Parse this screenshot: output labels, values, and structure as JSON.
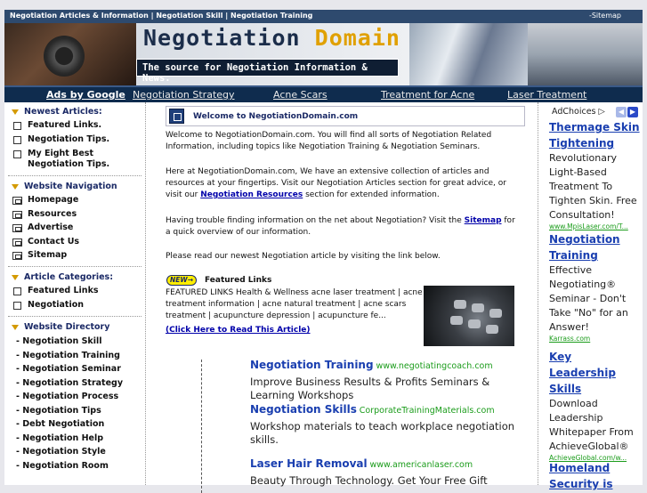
{
  "topbar": {
    "left_text": "Negotiation Articles & Information | Negotiation Skill | Negotiation Training",
    "right_text": "-Sitemap"
  },
  "banner": {
    "title_part1": "Negotiation",
    "title_part2": "Domain",
    "tagline": "The source for Negotiation Information & News."
  },
  "nav": {
    "ads_label": "Ads by Google",
    "links": [
      "Negotiation Strategy",
      "Acne Scars",
      "Treatment for Acne",
      "Laser Treatment"
    ]
  },
  "left": {
    "newest_heading": "Newest Articles:",
    "newest": [
      "Featured Links.",
      "Negotiation Tips.",
      "My Eight Best Negotiation Tips."
    ],
    "nav_heading": "Website Navigation",
    "nav_items": [
      "Homepage",
      "Resources",
      "Advertise",
      "Contact Us",
      "Sitemap"
    ],
    "cat_heading": "Article Categories:",
    "categories": [
      "Featured Links",
      "Negotiation"
    ],
    "dir_heading": "Website Directory",
    "directory": [
      "- Negotiation Skill",
      "- Negotiation Training",
      "- Negotiation Seminar",
      "- Negotiation Strategy",
      "- Negotiation Process",
      "- Negotiation Tips",
      "- Debt Negotiation",
      "- Negotiation Help",
      "- Negotiation Style",
      "- Negotiation Room"
    ]
  },
  "center": {
    "welcome_title": "Welcome to NegotiationDomain.com",
    "p1": "Welcome to NegotiationDomain.com. You will find all sorts of Negotiation Related Information, including topics like Negotiation Training & Negotiation Seminars.",
    "p2_a": "Here at NegotiationDomain.com, We have an extensive collection of articles and resources at your fingertips. Visit our Negotiation Articles section for great advice, or visit our ",
    "p2_link": "Negotiation Resources",
    "p2_b": " section for extended information.",
    "p3_a": "Having trouble finding information on the net about Negotiation? Visit the ",
    "p3_link": "Sitemap",
    "p3_b": " for a quick overview of our information.",
    "p4": "Please read our newest Negotiation article by visiting the link below.",
    "new_badge": "NEW",
    "feat_title": "Featured Links",
    "feat_text": "FEATURED LINKS Health & Wellness acne laser treatment | acne treatment information | acne natural treatment | acne scars treatment | acupuncture depression | acupuncture fe...",
    "feat_link": "(Click Here to Read This Article)",
    "ads": [
      {
        "title": "Negotiation Training",
        "domain": "www.negotiatingcoach.com",
        "body": "Improve Business Results & Profits Seminars & Learning Workshops"
      },
      {
        "title": "Negotiation Skills",
        "domain": "CorporateTrainingMaterials.com",
        "body": "Workshop materials to teach workplace negotiation skills."
      },
      {
        "title": "Laser Hair Removal",
        "domain": "www.americanlaser.com",
        "body": "Beauty Through Technology. Get Your Free Gift"
      }
    ]
  },
  "right": {
    "adchoices": "AdChoices",
    "ads": [
      {
        "title": "Thermage Skin Tightening",
        "body": "Revolutionary Light-Based Treatment To Tighten Skin. Free Consultation!",
        "url": "www.MpisLaser.com/T..."
      },
      {
        "title": "Negotiation Training",
        "body": "Effective Negotiating® Seminar - Don't Take \"No\" for an Answer!",
        "url": "Karrass.com"
      },
      {
        "title": "Key Leadership Skills",
        "body": "Download Leadership Whitepaper From AchieveGlobal®",
        "url": "AchieveGlobal.com/w..."
      },
      {
        "title": "Homeland Security is",
        "body": "",
        "url": ""
      }
    ]
  }
}
